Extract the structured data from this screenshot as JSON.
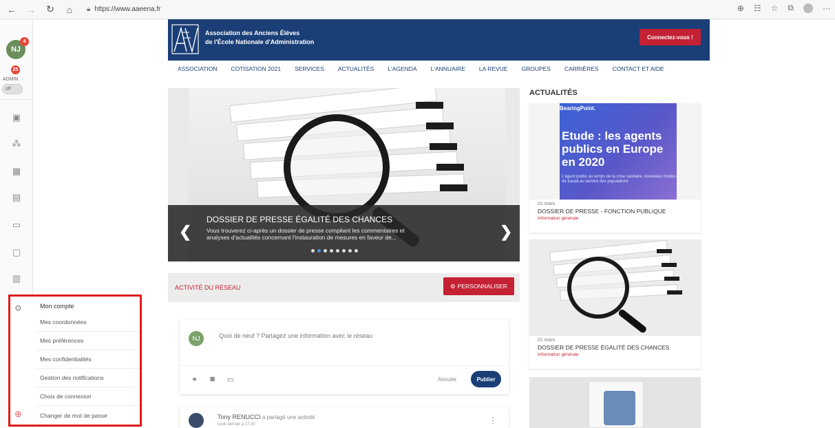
{
  "browser": {
    "url": "https://www.aaeena.fr",
    "back_icon": "arrow-left-icon",
    "reload_icon": "reload-icon"
  },
  "rail": {
    "avatar_initials": "NJ",
    "avatar_badge": "4",
    "admin_badge": "25",
    "admin_label": "ADMIN",
    "toggle_label": "off"
  },
  "account_menu": {
    "title": "Mon compte",
    "items": [
      "Mes coordonnées",
      "Mes préférences",
      "Mes confidentialités",
      "Gestion des notifications",
      "Choix de connexion",
      "Changer de mot de passe"
    ]
  },
  "header": {
    "site_name_line1": "Association des Anciens Élèves",
    "site_name_line2": "de l'École Nationale d'Administration",
    "connect_label": "Connectez-vous !"
  },
  "nav": {
    "items": [
      "ASSOCIATION",
      "COTISATION 2021",
      "SERVICES",
      "ACTUALITÉS",
      "L'AGENDA",
      "L'ANNUAIRE",
      "LA REVUE",
      "GROUPES",
      "CARRIÈRES",
      "CONTACT ET AIDE"
    ]
  },
  "carousel": {
    "title": "DOSSIER DE PRESSE ÉGALITÉ DES CHANCES",
    "text_line1": "Vous trouverez ci-après un dossier de presse compilant les commentaires et",
    "text_line2": "analyses d'actualités concernant l'instauration de mesures en faveur de...",
    "prev": "❮",
    "next": "❯",
    "slide_count": 8,
    "active_index": 1
  },
  "activity": {
    "title": "ACTIVITÉ DU RÉSEAU",
    "personalize_label": "PERSONNALISER"
  },
  "composer": {
    "avatar_initials": "NJ",
    "placeholder": "Quoi de neuf ? Partagez une information avec le réseau",
    "cancel_label": "Annuler",
    "publish_label": "Publier"
  },
  "feed": {
    "author": "Tony RENUCCI",
    "action": "a partagé une activité",
    "time": "lundi dernier à 17:30"
  },
  "news": {
    "title": "ACTUALITÉS",
    "cards": [
      {
        "brand": "BearingPoint.",
        "headline_img_l1": "Etude : les agents",
        "headline_img_l2": "publics en Europe",
        "headline_img_l3": "en 2020",
        "sub_img": "L'agent public au temps de la crise sanitaire, nouveaux modes de travail au service des populations",
        "date": "01 mars",
        "headline": "DOSSIER DE PRESSE - FONCTION PUBLIQUE",
        "category": "Information générale"
      },
      {
        "date": "01 mars",
        "headline": "DOSSIER DE PRESSE ÉGALITÉ DES CHANCES",
        "category": "Information générale"
      }
    ]
  }
}
